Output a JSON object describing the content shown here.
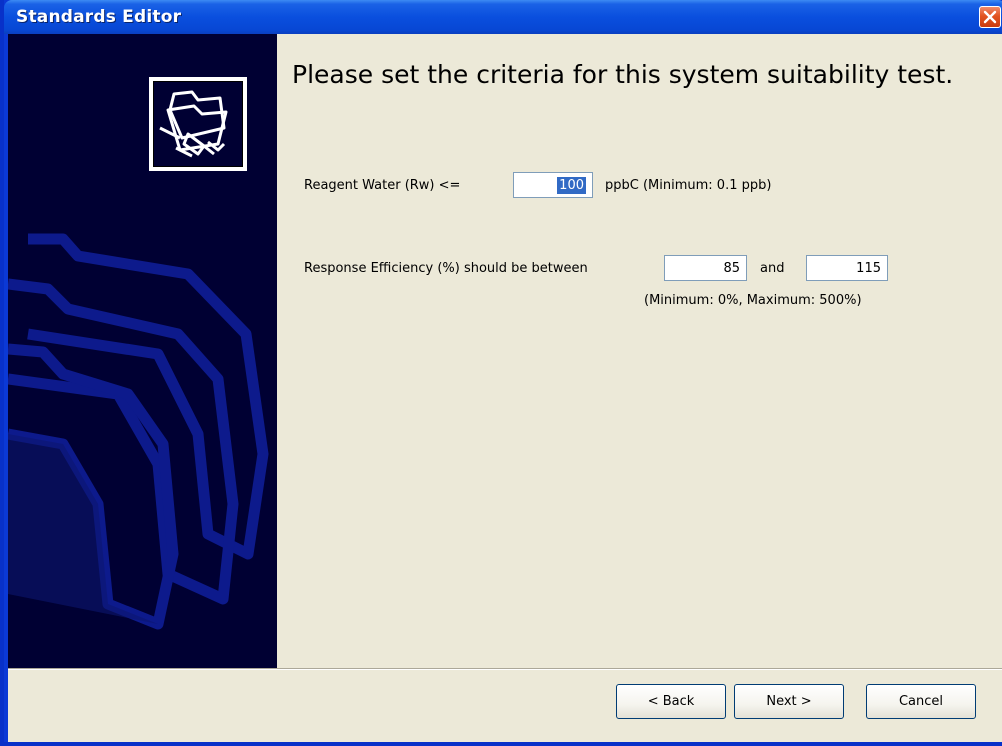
{
  "window": {
    "title": "Standards Editor"
  },
  "page": {
    "heading": "Please set the criteria for this system suitability test."
  },
  "reagent": {
    "label": "Reagent Water (Rw) <=",
    "value": "100",
    "unit_text": "ppbC (Minimum: 0.1 ppb)"
  },
  "efficiency": {
    "label": "Response Efficiency (%) should be between",
    "min_value": "85",
    "and_text": "and",
    "max_value": "115",
    "range_note": "(Minimum: 0%, Maximum: 500%)"
  },
  "buttons": {
    "back": "< Back",
    "next": "Next >",
    "cancel": "Cancel"
  },
  "icons": {
    "close": "close-icon",
    "wizard": "folder-network-icon",
    "background": "folders-watermark"
  },
  "colors": {
    "titlebar": "#0a4fde",
    "side_panel": "#000033",
    "dialog_bg": "#ece9d8",
    "selection": "#316ac5"
  }
}
